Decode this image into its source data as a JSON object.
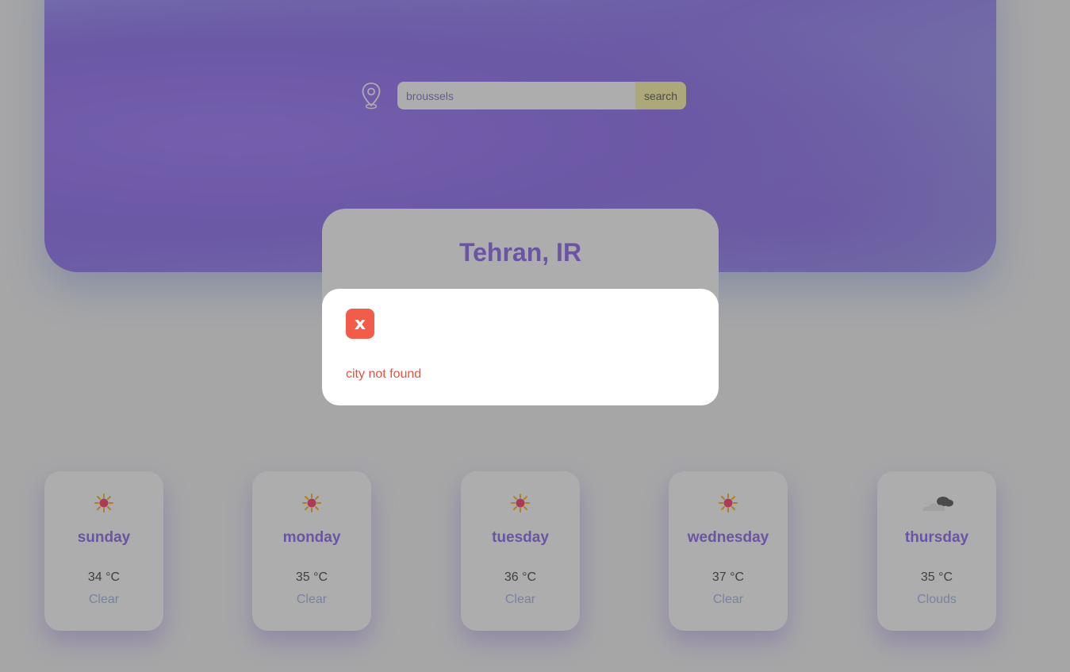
{
  "search": {
    "value": "broussels",
    "button_label": "search"
  },
  "current": {
    "city": "Tehran, IR"
  },
  "forecast": [
    {
      "day": "sunday",
      "temp": "34 °C",
      "condition": "Clear",
      "icon": "sun-icon"
    },
    {
      "day": "monday",
      "temp": "35 °C",
      "condition": "Clear",
      "icon": "sun-icon"
    },
    {
      "day": "tuesday",
      "temp": "36 °C",
      "condition": "Clear",
      "icon": "sun-icon"
    },
    {
      "day": "wednesday",
      "temp": "37 °C",
      "condition": "Clear",
      "icon": "sun-icon"
    },
    {
      "day": "thursday",
      "temp": "35 °C",
      "condition": "Clouds",
      "icon": "cloud-icon"
    }
  ],
  "modal": {
    "close_label": "x",
    "message": "city not found"
  },
  "colors": {
    "accent": "#8c67ee",
    "error": "#f25c4b",
    "search_button": "#fff6a8"
  }
}
